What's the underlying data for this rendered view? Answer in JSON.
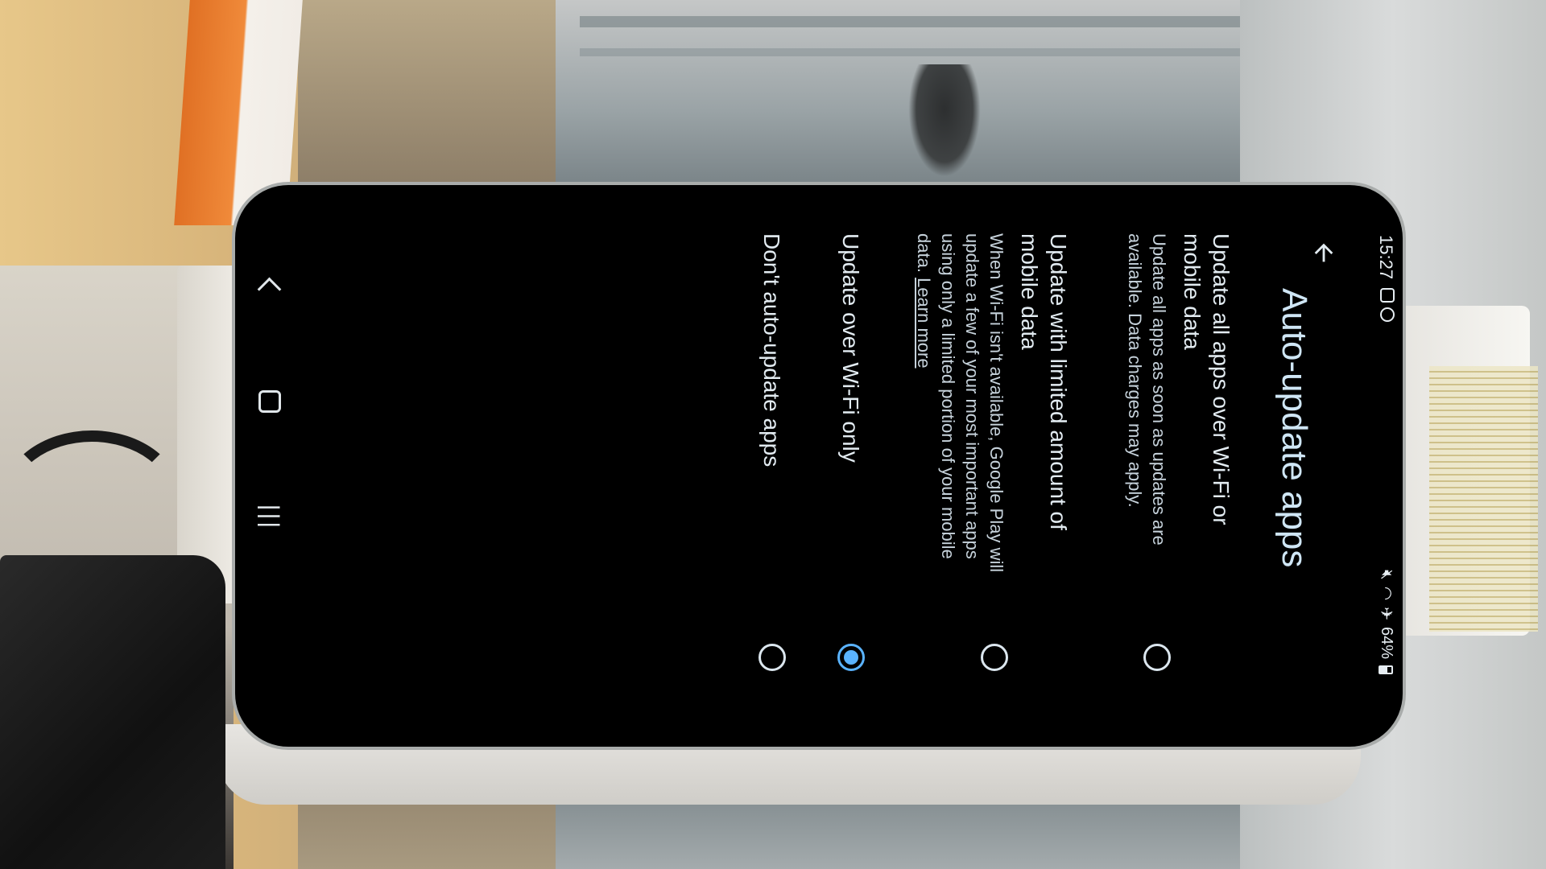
{
  "status_bar": {
    "time": "15:27",
    "battery": "64%",
    "icons_left": [
      "notification-icon",
      "sync-icon"
    ],
    "icons_right": [
      "mute-icon",
      "wifi-icon",
      "airplane-icon",
      "battery-icon"
    ]
  },
  "header": {
    "title": "Auto-update apps",
    "back_icon": "arrow-back-icon"
  },
  "options": [
    {
      "title": "Update all apps over Wi-Fi or mobile data",
      "description": "Update all apps as soon as updates are available. Data charges may apply.",
      "selected": false
    },
    {
      "title": "Update with limited amount of mobile data",
      "description": "When Wi-Fi isn't available, Google Play will update a few of your most important apps using only a limited portion of your mobile data.",
      "link": "Learn more",
      "selected": false
    },
    {
      "title": "Update over Wi-Fi only",
      "selected": true
    },
    {
      "title": "Don't auto-update apps",
      "selected": false
    }
  ],
  "nav_bar": {
    "recents_icon": "recents-icon",
    "home_icon": "home-icon",
    "back_icon": "nav-back-icon"
  },
  "colors": {
    "accent": "#5ab3ff",
    "screen_bg": "#000000",
    "text": "#dce5ec"
  }
}
